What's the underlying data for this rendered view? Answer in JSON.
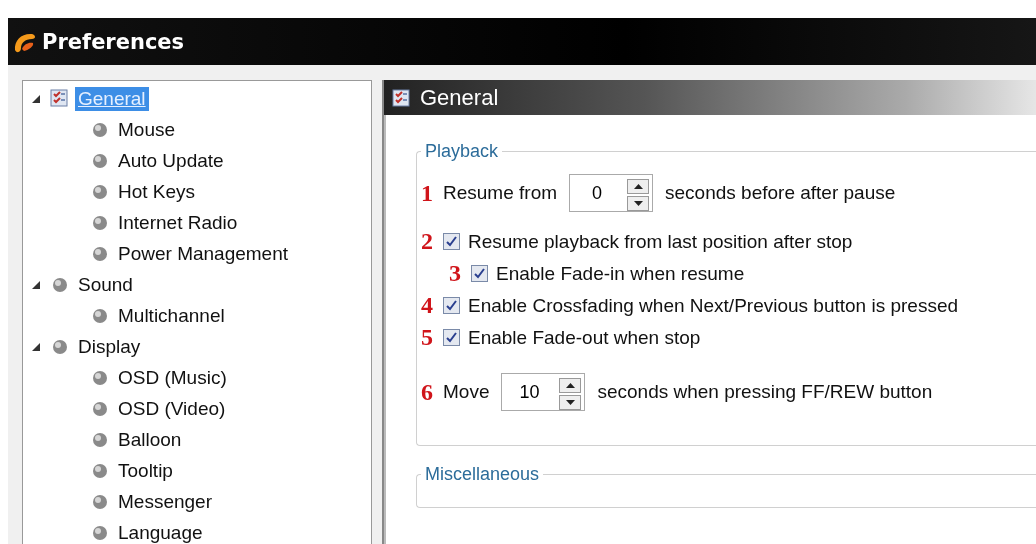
{
  "window": {
    "title": "Preferences"
  },
  "tree": [
    {
      "label": "General",
      "selected": true,
      "expanded": true,
      "children": [
        {
          "label": "Mouse",
          "selected": false
        },
        {
          "label": "Auto Update",
          "selected": false
        },
        {
          "label": "Hot Keys",
          "selected": false
        },
        {
          "label": "Internet Radio",
          "selected": false
        },
        {
          "label": "Power Management",
          "selected": false
        }
      ]
    },
    {
      "label": "Sound",
      "selected": false,
      "expanded": true,
      "children": [
        {
          "label": "Multichannel",
          "selected": false
        }
      ]
    },
    {
      "label": "Display",
      "selected": false,
      "expanded": true,
      "children": [
        {
          "label": "OSD (Music)",
          "selected": false
        },
        {
          "label": "OSD (Video)",
          "selected": false
        },
        {
          "label": "Balloon",
          "selected": false
        },
        {
          "label": "Tooltip",
          "selected": false
        },
        {
          "label": "Messenger",
          "selected": false
        },
        {
          "label": "Language",
          "selected": false
        }
      ]
    }
  ],
  "panel": {
    "title": "General",
    "groups": [
      {
        "legend": "Playback",
        "rows": [
          {
            "kind": "spin",
            "annotation": "1",
            "label": "Resume from",
            "value": "0",
            "suffix": "seconds before after pause"
          },
          {
            "kind": "checkbox",
            "annotation": "2",
            "label": "Resume playback from last position after stop",
            "checked": true,
            "indented": false
          },
          {
            "kind": "checkbox",
            "annotation": "3",
            "label": "Enable Fade-in when resume",
            "checked": true,
            "indented": true
          },
          {
            "kind": "checkbox",
            "annotation": "4",
            "label": "Enable Crossfading when Next/Previous button is pressed",
            "checked": true,
            "indented": false
          },
          {
            "kind": "checkbox",
            "annotation": "5",
            "label": "Enable Fade-out when stop",
            "checked": true,
            "indented": false
          },
          {
            "kind": "spin",
            "annotation": "6",
            "label": "Move",
            "value": "10",
            "suffix": "seconds when pressing FF/REW button"
          }
        ]
      },
      {
        "legend": "Miscellaneous"
      }
    ]
  }
}
